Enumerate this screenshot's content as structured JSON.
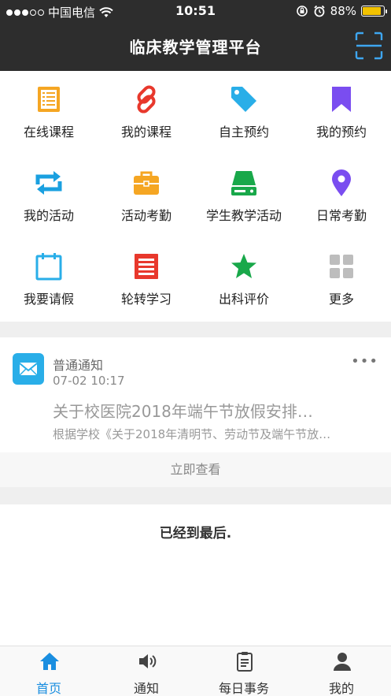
{
  "status_bar": {
    "carrier": "中国电信",
    "time": "10:51",
    "battery": "88%",
    "battery_level": 0.88
  },
  "nav": {
    "title": "临床教学管理平台",
    "scan_icon": "scan-icon"
  },
  "grid": [
    {
      "label": "在线课程",
      "icon": "course-list-icon",
      "color": "#f5a623"
    },
    {
      "label": "我的课程",
      "icon": "link-icon",
      "color": "#e8382c"
    },
    {
      "label": "自主预约",
      "icon": "tag-icon",
      "color": "#29aee8"
    },
    {
      "label": "我的预约",
      "icon": "bookmark-icon",
      "color": "#7a4df0"
    },
    {
      "label": "我的活动",
      "icon": "repeat-icon",
      "color": "#1aa0e0"
    },
    {
      "label": "活动考勤",
      "icon": "briefcase-icon",
      "color": "#f5a623"
    },
    {
      "label": "学生教学活动",
      "icon": "drive-icon",
      "color": "#19a84a"
    },
    {
      "label": "日常考勤",
      "icon": "location-pin-icon",
      "color": "#7a4df0"
    },
    {
      "label": "我要请假",
      "icon": "calendar-icon",
      "color": "#29aee8"
    },
    {
      "label": "轮转学习",
      "icon": "document-icon",
      "color": "#e8382c"
    },
    {
      "label": "出科评价",
      "icon": "star-icon",
      "color": "#19a84a"
    },
    {
      "label": "更多",
      "icon": "grid-more-icon",
      "color": "#bdbdbd"
    }
  ],
  "notice": {
    "icon": "mail-icon",
    "type": "普通通知",
    "time": "07-02 10:17",
    "more": "•••",
    "title": "关于校医院2018年端午节放假安排…",
    "summary": "根据学校《关于2018年清明节、劳动节及端午节放…",
    "view_button": "立即查看"
  },
  "end_text": "已经到最后.",
  "tabs": [
    {
      "label": "首页",
      "icon": "home-icon",
      "active": true
    },
    {
      "label": "通知",
      "icon": "speaker-icon",
      "active": false
    },
    {
      "label": "每日事务",
      "icon": "clipboard-icon",
      "active": false
    },
    {
      "label": "我的",
      "icon": "person-icon",
      "active": false
    }
  ],
  "colors": {
    "header_bg": "#2d2d2d",
    "accent_blue": "#1a8ee0",
    "battery_fill": "#f2c200"
  }
}
